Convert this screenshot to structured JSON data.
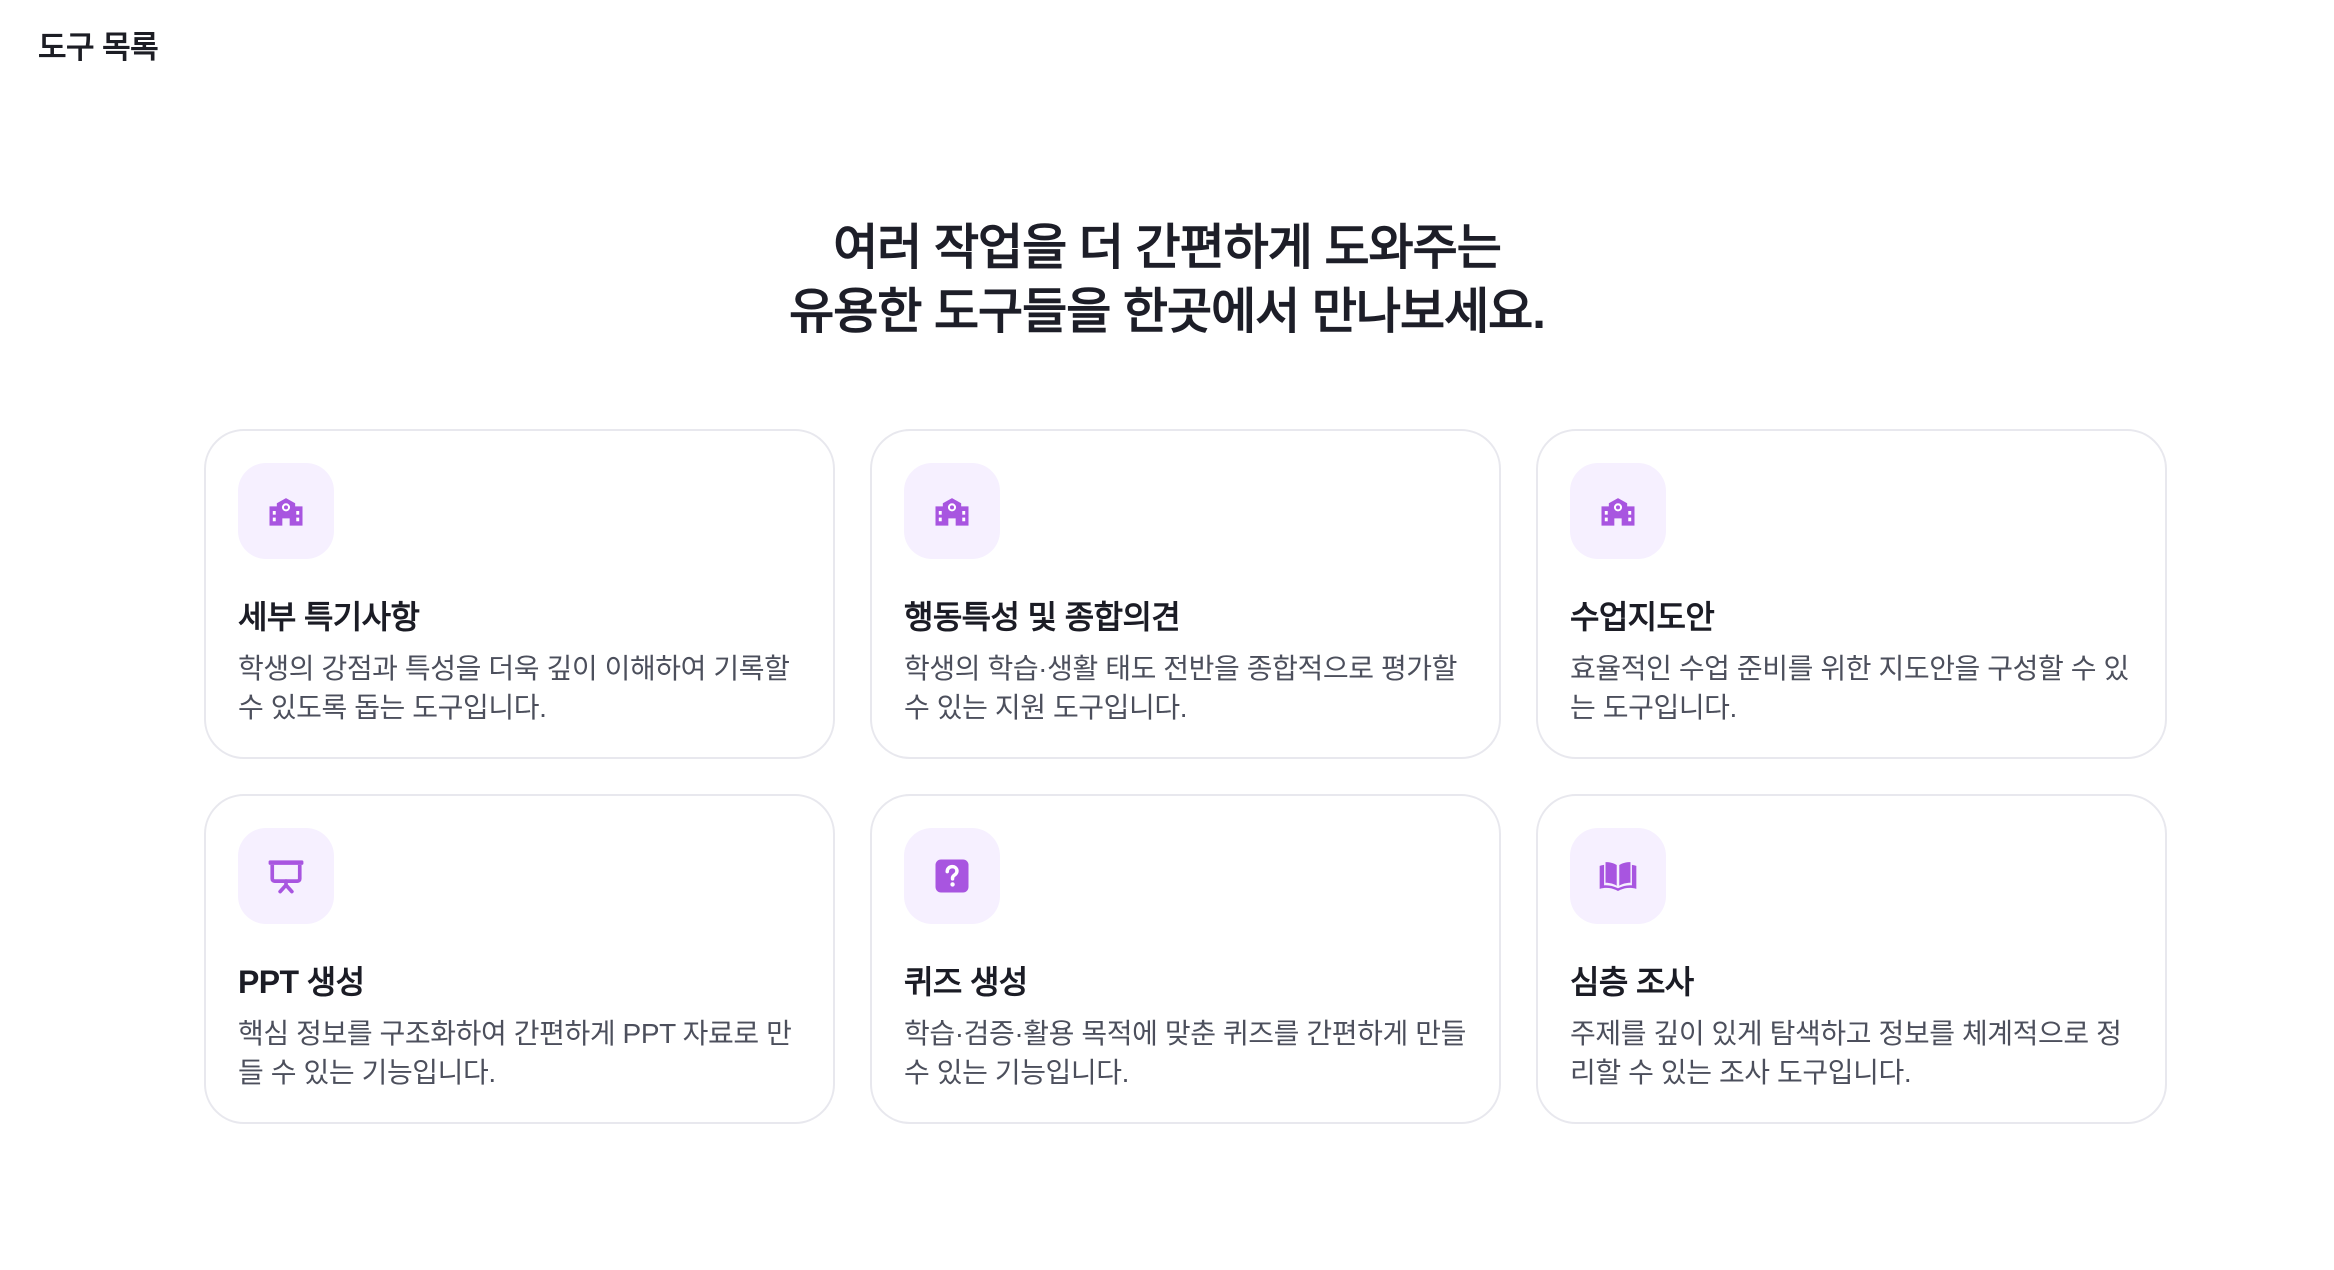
{
  "header": {
    "title": "도구 목록"
  },
  "hero": {
    "line1": "여러 작업을 더 간편하게 도와주는",
    "line2": "유용한 도구들을 한곳에서 만나보세요."
  },
  "colors": {
    "accent": "#a855e0",
    "icon_bg": "#f6f0ff",
    "card_border": "#e8e8ee"
  },
  "cards": [
    {
      "icon": "school-icon",
      "title": "세부 특기사항",
      "description": "학생의 강점과 특성을 더욱 깊이 이해하여 기록할 수 있도록 돕는 도구입니다."
    },
    {
      "icon": "school-icon",
      "title": "행동특성 및 종합의견",
      "description": "학생의 학습·생활 태도 전반을 종합적으로 평가할 수 있는 지원 도구입니다."
    },
    {
      "icon": "school-icon",
      "title": "수업지도안",
      "description": "효율적인 수업 준비를 위한 지도안을 구성할 수 있는 도구입니다."
    },
    {
      "icon": "presentation-icon",
      "title": "PPT 생성",
      "description": "핵심 정보를 구조화하여 간편하게 PPT 자료로 만들 수 있는 기능입니다."
    },
    {
      "icon": "quiz-icon",
      "title": "퀴즈 생성",
      "description": "학습·검증·활용 목적에 맞춘 퀴즈를 간편하게 만들 수 있는 기능입니다."
    },
    {
      "icon": "book-icon",
      "title": "심층 조사",
      "description": "주제를 깊이 있게 탐색하고 정보를 체계적으로 정리할 수 있는 조사 도구입니다."
    }
  ]
}
